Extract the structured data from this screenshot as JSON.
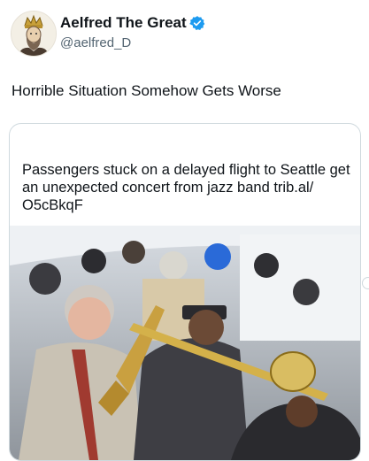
{
  "author": {
    "display_name": "Aelfred The Great",
    "handle": "@aelfred_D",
    "verified": true,
    "avatar_icon": "crowned-king-icon"
  },
  "post": {
    "text": "Horrible Situation Somehow Gets Worse"
  },
  "link_card": {
    "title": "Passengers stuck on a delayed flight to Seattle get an unexpected concert from jazz band trib.al/ O5cBkqF",
    "image_description_icon": "photo-icon"
  },
  "colors": {
    "text": "#0f1419",
    "secondary_text": "#536471",
    "verified_blue": "#1d9bf0",
    "border": "#cfd9de"
  }
}
